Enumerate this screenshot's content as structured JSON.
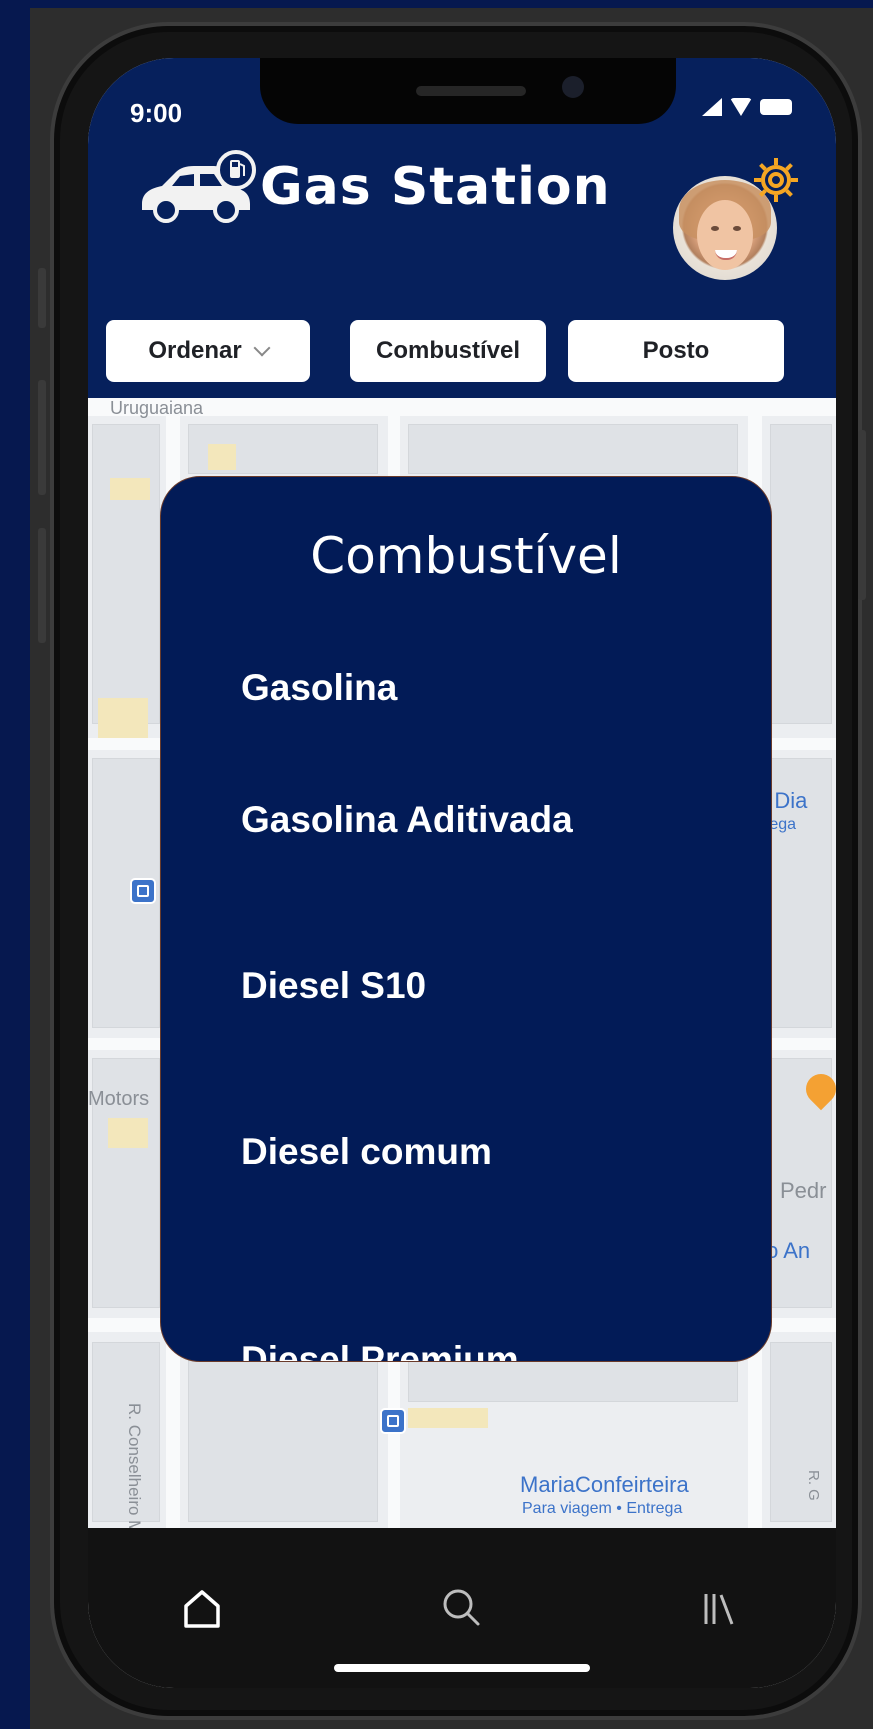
{
  "status_bar": {
    "time": "9:00",
    "signal_icon": "cellular-signal-icon",
    "wifi_icon": "wifi-icon",
    "battery_icon": "battery-icon"
  },
  "header": {
    "title": "Gas Station",
    "logo_icon": "car-fuel-logo-icon",
    "avatar": "user-avatar",
    "settings_icon": "gear-icon",
    "accent": "#f5a623",
    "background": "#06205c"
  },
  "filters": {
    "sort_label": "Ordenar",
    "fuel_label": "Combustível",
    "station_label": "Posto"
  },
  "map": {
    "street_top": "Uruguaiana",
    "label_motors": "Motors",
    "label_dia": "o Dia",
    "label_dia_sub": "rega",
    "label_pedr": "Pedr",
    "label_to_an": "to An",
    "street_vertical": "R. Conselheiro Mata",
    "street_vertical_right": "R. G",
    "place_name": "MariaConfeirteira",
    "place_sub": "Para viagem • Entrega"
  },
  "popup": {
    "title": "Combustível",
    "options": [
      "Gasolina",
      "Gasolina Aditivada",
      "Diesel S10",
      "Diesel comum",
      "Diesel Premium"
    ],
    "background": "#021b57"
  },
  "bottom_nav": {
    "home_icon": "home-icon",
    "search_icon": "search-icon",
    "library_icon": "library-icon"
  }
}
